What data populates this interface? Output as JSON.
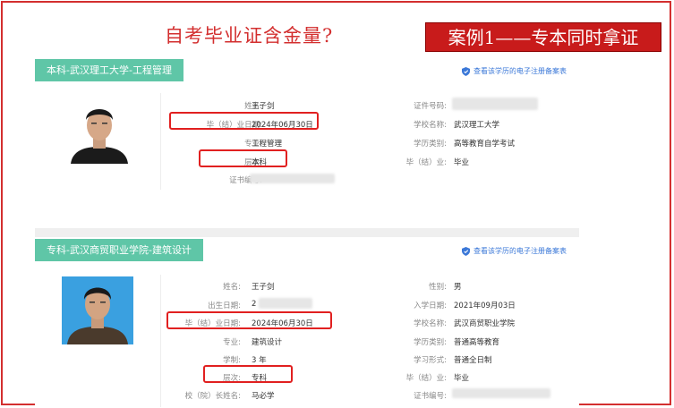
{
  "header": {
    "title": "自考毕业证含金量?",
    "case_label": "案例1——专本同时拿证"
  },
  "records": [
    {
      "tab": "本科-武汉理工大学-工程管理",
      "verify_link": "查看该学历的电子注册备案表",
      "fields": {
        "name_label": "姓名:",
        "name": "王子剑",
        "grad_date_label": "毕（结）业日期:",
        "grad_date": "2024年06月30日",
        "major_label": "专业:",
        "major": "工程管理",
        "level_label": "层次:",
        "level": "本科",
        "cert_no_label": "证书编号:",
        "id_label": "证件号码:",
        "school_label": "学校名称:",
        "school": "武汉理工大学",
        "type_label": "学历类别:",
        "type": "高等教育自学考试",
        "status_label": "毕（结）业:",
        "status": "毕业"
      }
    },
    {
      "tab": "专科-武汉商贸职业学院-建筑设计",
      "verify_link": "查看该学历的电子注册备案表",
      "fields": {
        "name_label": "姓名:",
        "name": "王子剑",
        "birth_label": "出生日期:",
        "birth_partial": "2",
        "grad_date_label": "毕（结）业日期:",
        "grad_date": "2024年06月30日",
        "major_label": "专业:",
        "major": "建筑设计",
        "length_label": "学制:",
        "length": "3 年",
        "level_label": "层次:",
        "level": "专科",
        "president_label": "校（院）长姓名:",
        "president": "马必学",
        "gender_label": "性别:",
        "gender": "男",
        "enroll_label": "入学日期:",
        "enroll": "2021年09月03日",
        "school_label": "学校名称:",
        "school": "武汉商贸职业学院",
        "type_label": "学历类别:",
        "type": "普通高等教育",
        "mode_label": "学习形式:",
        "mode": "普通全日制",
        "status_label": "毕（结）业:",
        "status": "毕业",
        "cert_no_label": "证书编号:"
      }
    }
  ],
  "colors": {
    "accent_red": "#d32f2f",
    "tab_green": "#5fc6a7",
    "link_blue": "#3b78d8"
  }
}
